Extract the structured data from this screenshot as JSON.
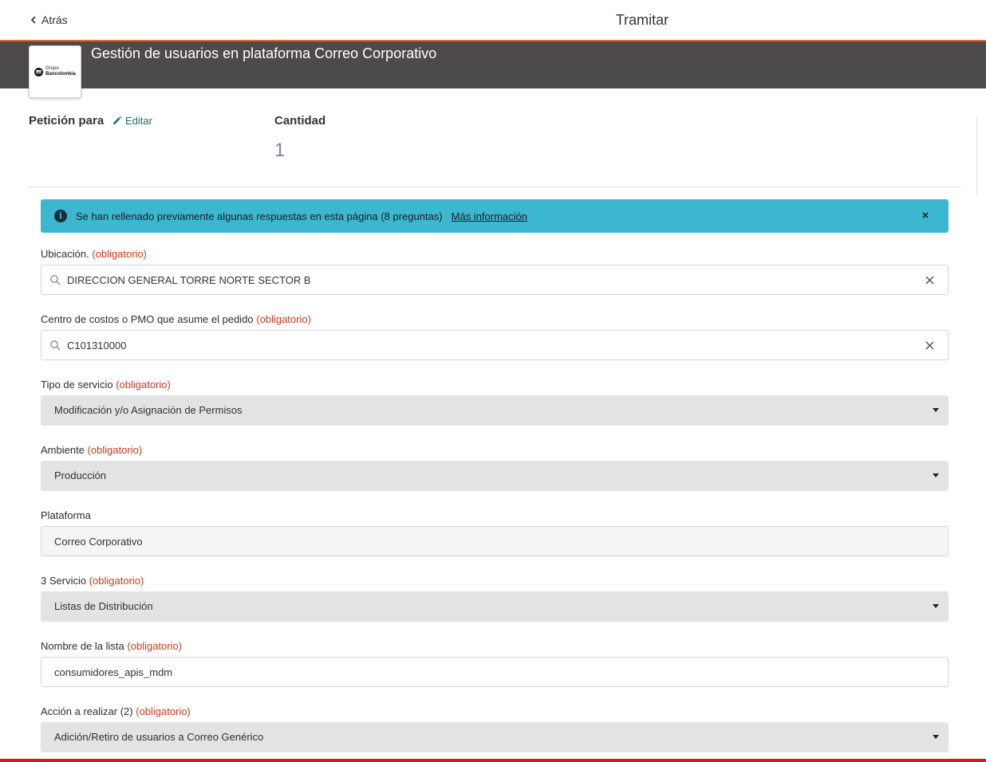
{
  "header": {
    "back_label": "Atrás",
    "title": "Tramitar"
  },
  "banner": {
    "logo": {
      "line1": "Grupo",
      "line2": "Bancolombia"
    },
    "title": "Gestión de usuarios en plataforma Correo Corporativo",
    "background_color": "#4d4b4a",
    "accent_color": "#e5692b"
  },
  "summary": {
    "requested_for_label": "Petición para",
    "edit_label": "Editar",
    "quantity_label": "Cantidad",
    "quantity_value": "1"
  },
  "info_banner": {
    "text": "Se han rellenado previamente algunas respuestas en esta página (8 preguntas)",
    "link": "Más información",
    "color": "#3db6cf"
  },
  "required_marker": "(obligatorio)",
  "fields": {
    "ubicacion": {
      "label": "Ubicación.",
      "value": "DIRECCION GENERAL TORRE NORTE SECTOR B"
    },
    "centro_costos": {
      "label": "Centro de costos o PMO que asume el pedido",
      "value": "C101310000"
    },
    "tipo_servicio": {
      "label": "Tipo de servicio",
      "value": "Modificación y/o Asignación de Permisos"
    },
    "ambiente": {
      "label": "Ambiente",
      "value": "Producción"
    },
    "plataforma": {
      "label": "Plataforma",
      "value": "Correo Corporativo"
    },
    "servicio": {
      "label": "3 Servicio",
      "value": "Listas de Distribución"
    },
    "nombre_lista": {
      "label": "Nombre de la lista",
      "value": "consumidores_apis_mdm"
    },
    "accion": {
      "label": "Acción a realizar (2)",
      "value": "Adición/Retiro de usuarios a Correo Genérico"
    }
  }
}
